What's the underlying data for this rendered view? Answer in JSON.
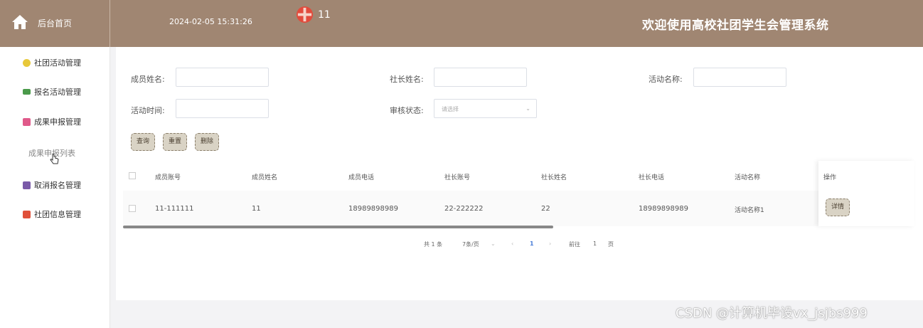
{
  "header": {
    "home_label": "后台首页",
    "datetime": "2024-02-05 15:31:26",
    "user_name": "11",
    "system_title": "欢迎使用高校社团学生会管理系统",
    "accent_color": "#a08672"
  },
  "sidebar": {
    "items": [
      {
        "label": "社团活动管理",
        "icon": "badge-icon",
        "color": "#e8c83a"
      },
      {
        "label": "报名活动管理",
        "icon": "monitor-icon",
        "color": "#4a9a4a"
      },
      {
        "label": "成果申报管理",
        "icon": "document-icon",
        "color": "#e05a8a"
      },
      {
        "label": "取消报名管理",
        "icon": "stack-icon",
        "color": "#7a5aa8"
      },
      {
        "label": "社团信息管理",
        "icon": "grid-icon",
        "color": "#e0503a"
      }
    ],
    "submenu_label": "成果申报列表"
  },
  "filters": {
    "member_name_label": "成员姓名:",
    "leader_name_label": "社长姓名:",
    "activity_name_label": "活动名称:",
    "activity_time_label": "活动时间:",
    "review_status_label": "审核状态:",
    "review_status_placeholder": "请选择"
  },
  "buttons": {
    "query": "查询",
    "reset": "重置",
    "delete": "删除"
  },
  "table": {
    "columns": [
      "成员账号",
      "成员姓名",
      "成员电话",
      "社长账号",
      "社长姓名",
      "社长电话",
      "活动名称",
      "操作"
    ],
    "rows": [
      {
        "member_account": "11-111111",
        "member_name": "11",
        "member_phone": "18989898989",
        "leader_account": "22-222222",
        "leader_name": "22",
        "leader_phone": "18989898989",
        "activity_name": "活动名称1",
        "action": "详情"
      }
    ]
  },
  "pagination": {
    "total": "共 1 条",
    "page_size": "7条/页",
    "current_page": "1",
    "goto_label": "前往",
    "goto_value": "1",
    "page_unit": "页"
  },
  "watermark": "CSDN @计算机毕设vx_jsjbs999"
}
